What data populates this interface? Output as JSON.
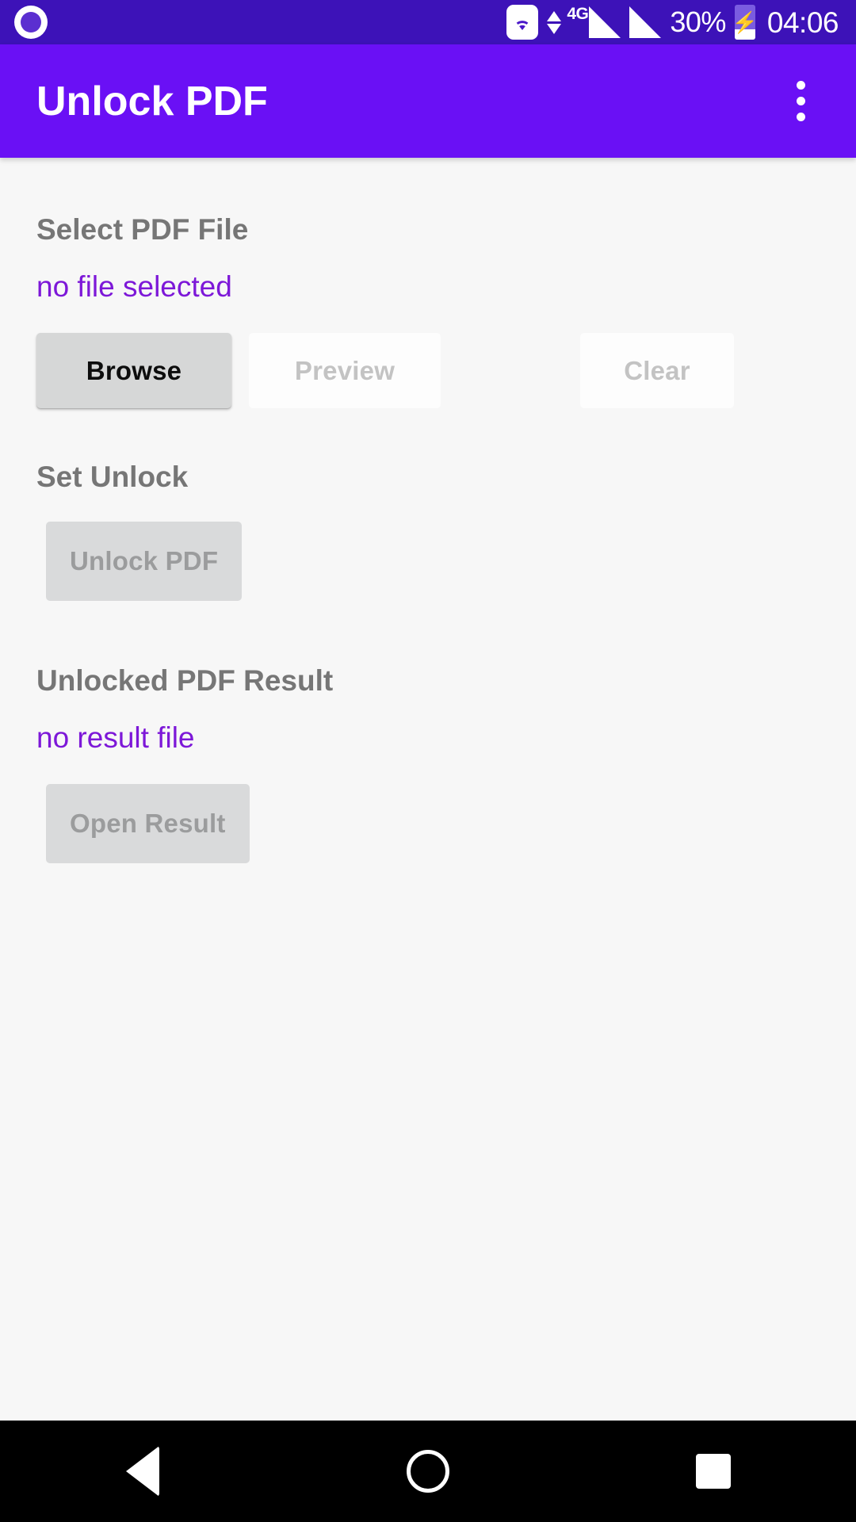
{
  "status_bar": {
    "notification_icon": "notification-dot-icon",
    "wifi_icon": "wifi-icon",
    "data_transfer_icon": "data-up-down-arrows-icon",
    "network_type": "4G",
    "signal_icon_1": "cellular-signal-icon",
    "signal_icon_2": "cellular-signal-icon",
    "battery_percent": "30%",
    "battery_icon": "battery-charging-icon",
    "battery_bolt": "⚡",
    "time": "04:06"
  },
  "app_bar": {
    "title": "Unlock PDF",
    "overflow_icon": "overflow-menu-icon"
  },
  "main": {
    "select_section": {
      "title": "Select PDF File",
      "file_status": "no file selected",
      "buttons": {
        "browse": "Browse",
        "preview": "Preview",
        "clear": "Clear"
      }
    },
    "unlock_section": {
      "title": "Set Unlock",
      "button": "Unlock PDF"
    },
    "result_section": {
      "title": "Unlocked PDF Result",
      "result_status": "no result file",
      "button": "Open Result"
    }
  },
  "nav_bar": {
    "back": "back-icon",
    "home": "home-icon",
    "recents": "recents-icon"
  },
  "colors": {
    "status_bar_bg": "#3d12b8",
    "app_bar_bg": "#6a10f5",
    "content_bg": "#f7f7f7",
    "section_title": "#767676",
    "accent_purple": "#7d18d8",
    "button_enabled_bg": "#d6d7d7",
    "button_disabled_bg": "#d9dadb",
    "nav_bar_bg": "#000000"
  }
}
